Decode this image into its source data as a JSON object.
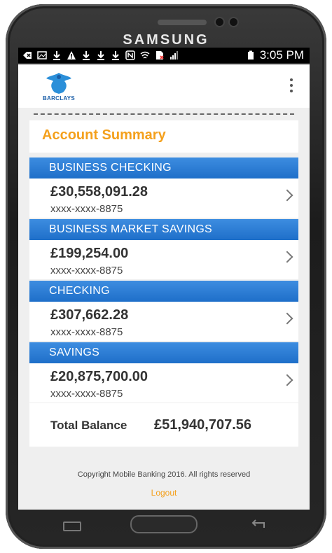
{
  "device": {
    "brand": "SAMSUNG"
  },
  "statusbar": {
    "time": "3:05 PM"
  },
  "app": {
    "logo_text": "BARCLAYS"
  },
  "summary": {
    "title": "Account Summary"
  },
  "accounts": [
    {
      "type": "BUSINESS CHECKING",
      "balance": "£30,558,091.28",
      "number": "xxxx-xxxx-8875"
    },
    {
      "type": "BUSINESS MARKET SAVINGS",
      "balance": "£199,254.00",
      "number": "xxxx-xxxx-8875"
    },
    {
      "type": "CHECKING",
      "balance": "£307,662.28",
      "number": "xxxx-xxxx-8875"
    },
    {
      "type": "SAVINGS",
      "balance": "£20,875,700.00",
      "number": "xxxx-xxxx-8875"
    }
  ],
  "total": {
    "label": "Total Balance",
    "value": "£51,940,707.56"
  },
  "footer": {
    "copyright": "Copyright Mobile Banking 2016. All rights reserved",
    "logout": "Logout"
  },
  "colors": {
    "accent": "#f4a01c",
    "header_blue": "#2a7dd6",
    "brand_blue": "#1a5ea8"
  }
}
